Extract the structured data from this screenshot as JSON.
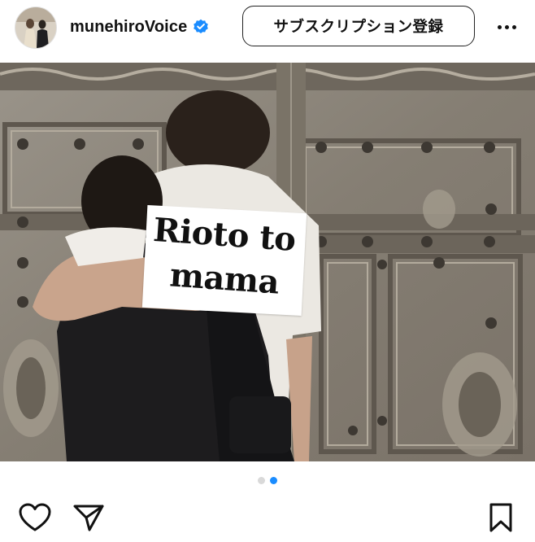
{
  "header": {
    "username": "munehiroVoice",
    "verified": true,
    "subscribe_label": "サブスクリプション登録",
    "more_icon": "more-horizontal-icon"
  },
  "post": {
    "sticker_lines": [
      "Rioto to",
      "mama"
    ],
    "carousel": {
      "count": 2,
      "active_index": 1
    }
  },
  "actions": {
    "like_icon": "heart-icon",
    "share_icon": "send-icon",
    "save_icon": "bookmark-icon"
  },
  "colors": {
    "accent": "#1a8cff",
    "verified_badge": "#1a8cff",
    "text": "#111111"
  }
}
